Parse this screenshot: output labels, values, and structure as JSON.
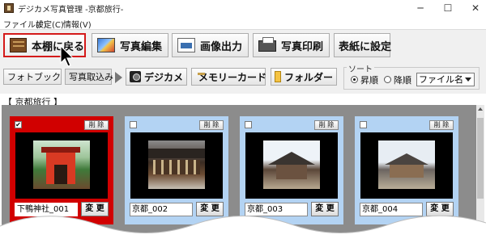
{
  "window": {
    "title": "デジカメ写真管理 -京都旅行-",
    "minimize_glyph": "─",
    "maximize_glyph": "☐",
    "close_glyph": "✕"
  },
  "menu": {
    "items": [
      {
        "label": "ファイル(F)"
      },
      {
        "label": "設定(C)"
      },
      {
        "label": "情報(V)"
      }
    ]
  },
  "toolbar": {
    "back_label": "本棚に戻る",
    "edit_label": "写真編集",
    "output_label": "画像出力",
    "print_label": "写真印刷",
    "cover_label": "表紙に設定"
  },
  "sources": {
    "photobook": "フォトブック",
    "import": "写真取込み",
    "camera": "デジカメ",
    "memory_card": "メモリーカード",
    "folder": "フォルダー"
  },
  "sort": {
    "legend": "ソート",
    "ascending": "昇順",
    "descending": "降順",
    "selected": "ascending",
    "field": "ファイル名"
  },
  "album": {
    "label": "【 京都旅行 】"
  },
  "photos": [
    {
      "name": "下鴨神社_001",
      "checked": true,
      "delete_label": "削 除",
      "change_label": "変 更",
      "art": "shrine"
    },
    {
      "name": "京都_002",
      "checked": false,
      "delete_label": "削 除",
      "change_label": "変 更",
      "art": "temple"
    },
    {
      "name": "京都_003",
      "checked": false,
      "delete_label": "削 除",
      "change_label": "変 更",
      "art": "hall"
    },
    {
      "name": "京都_004",
      "checked": false,
      "delete_label": "削 除",
      "change_label": "変 更",
      "art": "house"
    }
  ],
  "colors": {
    "selected_card": "#d10000",
    "card": "#b3d3f3",
    "gallery_bg": "#8c8c8c",
    "active_button_border": "#d41a1a"
  },
  "icons": {
    "back": "bookshelf-icon",
    "edit": "photo-edit-icon",
    "output": "image-output-icon",
    "print": "printer-icon",
    "camera": "camera-icon",
    "memory_card": "memory-card-icon",
    "folder": "folder-icon"
  }
}
